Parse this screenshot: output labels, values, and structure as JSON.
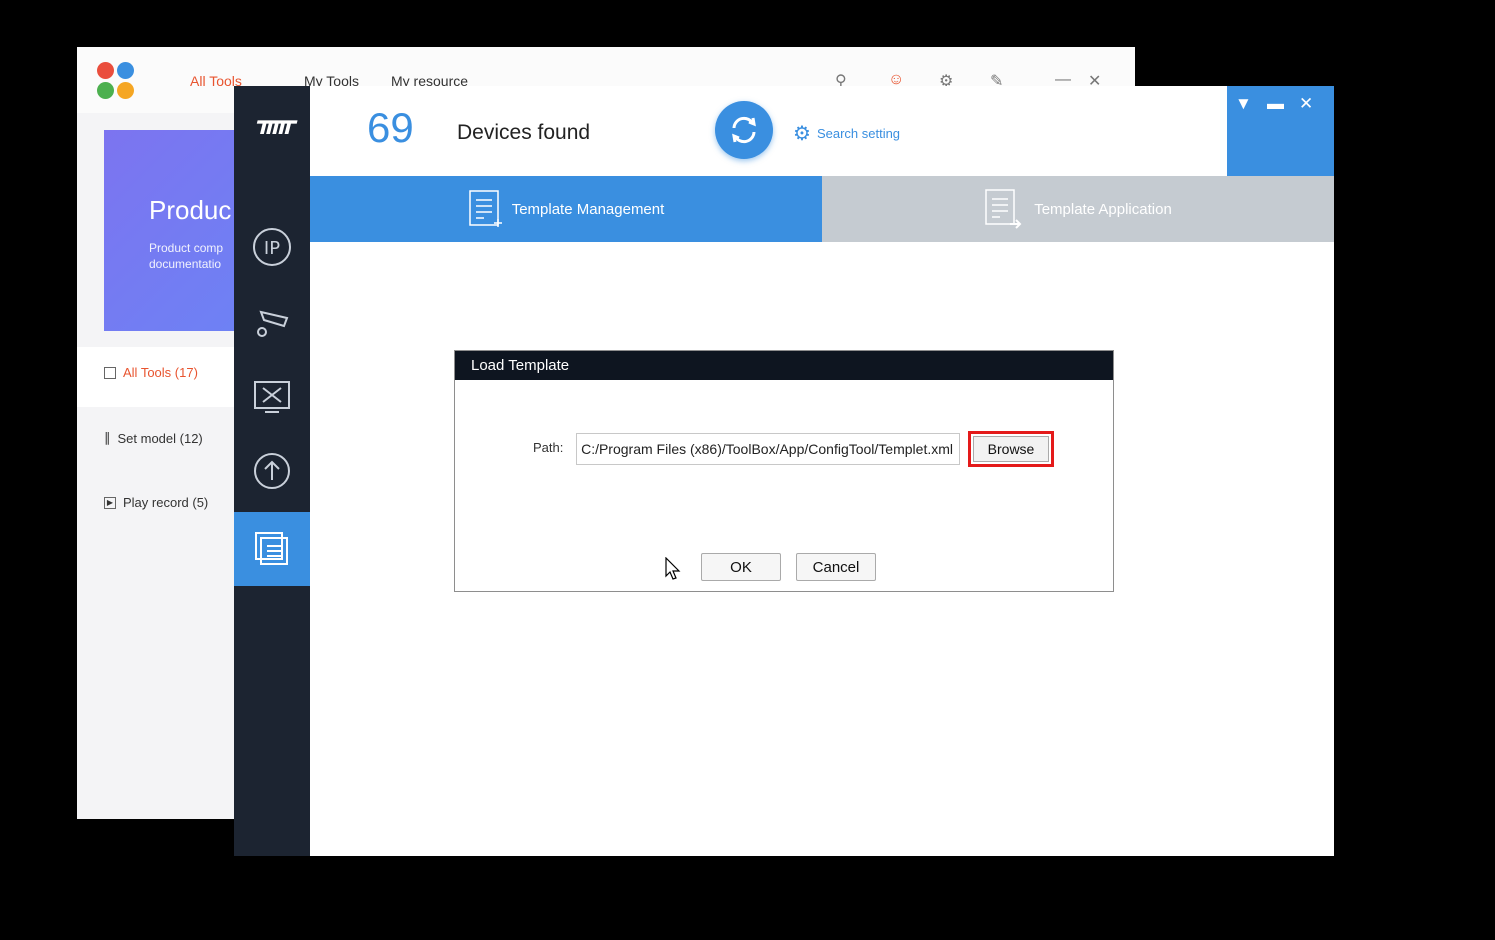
{
  "background_app": {
    "nav": [
      "All Tools",
      "My Tools",
      "My resource"
    ],
    "banner_title": "Produc",
    "banner_subtitle_1": "Product comp",
    "banner_subtitle_2": "documentatio",
    "side_items": [
      "All Tools (17)",
      "Set model (12)",
      "Play record (5)"
    ],
    "accent": "#e8542f"
  },
  "main_app": {
    "logo": "D",
    "device_count": "69",
    "devices_found_label": "Devices found",
    "search_setting_label": "Search setting",
    "tabs": [
      {
        "label": "Template Management",
        "active": true
      },
      {
        "label": "Template Application",
        "active": false
      }
    ],
    "accent": "#3a8fe0"
  },
  "dialog": {
    "title": "Load Template",
    "path_label": "Path:",
    "path_value": "C:/Program Files (x86)/ToolBox/App/ConfigTool/Templet.xml",
    "browse_label": "Browse",
    "ok_label": "OK",
    "cancel_label": "Cancel"
  }
}
